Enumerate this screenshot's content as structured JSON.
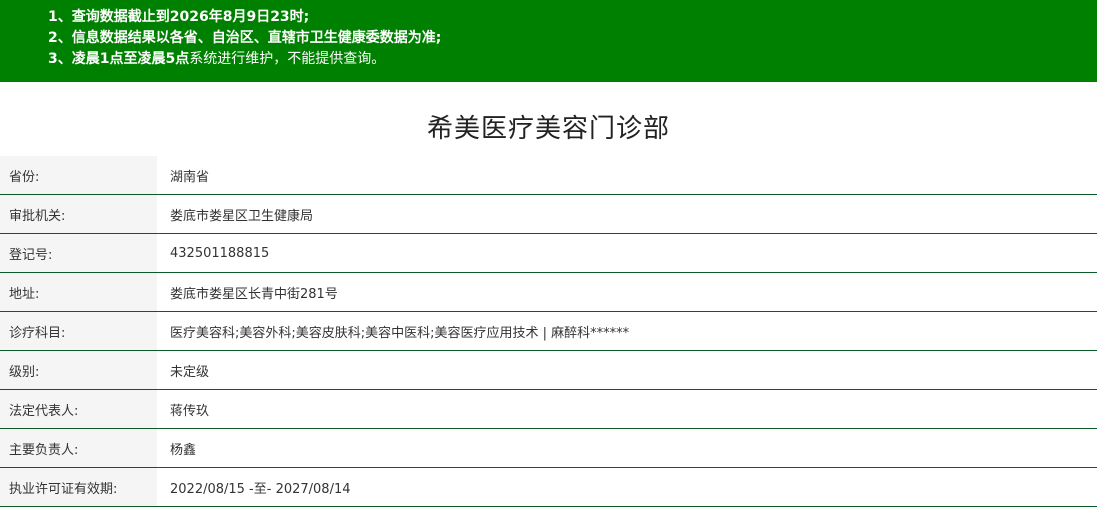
{
  "notice": {
    "line1": "1、查询数据截止到2026年8月9日23时;",
    "line2": "2、信息数据结果以各省、自治区、直辖市卫生健康委数据为准;",
    "line3_bold": "3、凌晨1点至凌晨5点",
    "line3_rest": "系统进行维护，不能提供查询。"
  },
  "title": "希美医疗美容门诊部",
  "rows": [
    {
      "label": "省份:",
      "value": "湖南省"
    },
    {
      "label": "审批机关:",
      "value": "娄底市娄星区卫生健康局"
    },
    {
      "label": "登记号:",
      "value": "432501188815"
    },
    {
      "label": "地址:",
      "value": "娄底市娄星区长青中街281号"
    },
    {
      "label": "诊疗科目:",
      "value": "医疗美容科;美容外科;美容皮肤科;美容中医科;美容医疗应用技术 | 麻醉科******"
    },
    {
      "label": "级别:",
      "value": "未定级"
    },
    {
      "label": "法定代表人:",
      "value": "蒋传玖"
    },
    {
      "label": "主要负责人:",
      "value": "杨鑫"
    },
    {
      "label": "执业许可证有效期:",
      "value": "2022/08/15 -至- 2027/08/14"
    }
  ],
  "colors": {
    "banner": "#008000",
    "label_bg": "#f5f5f5",
    "divider": "#0a5a2a"
  }
}
